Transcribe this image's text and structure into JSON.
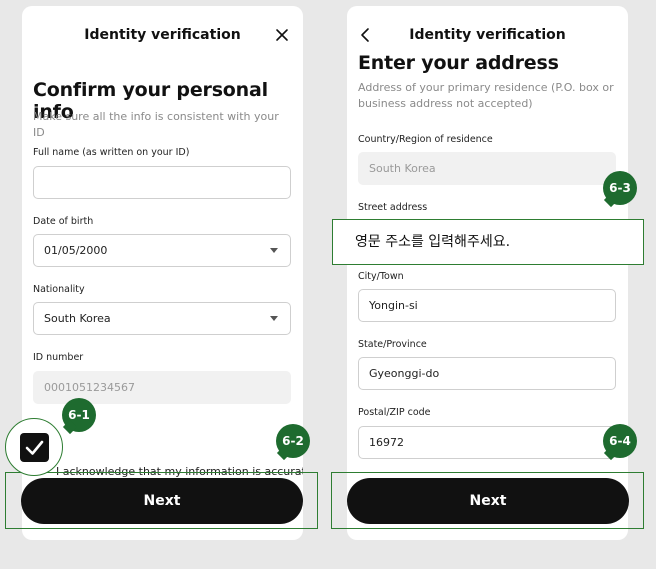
{
  "left": {
    "header_title": "Identity verification",
    "title": "Confirm your personal info",
    "subtitle": "Make sure all the info is consistent with your ID",
    "full_name": {
      "label": "Full name (as written on your ID)",
      "value": ""
    },
    "dob": {
      "label": "Date of birth",
      "value": "01/05/2000"
    },
    "nationality": {
      "label": "Nationality",
      "value": "South Korea"
    },
    "id_number": {
      "label": "ID number",
      "value": "0001051234567"
    },
    "acknowledge": "I acknowledge that my information is accurate",
    "next": "Next"
  },
  "right": {
    "header_title": "Identity verification",
    "title": "Enter your address",
    "subtitle": "Address of your primary residence (P.O. box or business address not accepted)",
    "country": {
      "label": "Country/Region of residence",
      "value": "South Korea"
    },
    "street": {
      "label": "Street address"
    },
    "city": {
      "label": "City/Town",
      "value": "Yongin-si"
    },
    "state": {
      "label": "State/Province",
      "value": "Gyeonggi-do"
    },
    "postal": {
      "label": "Postal/ZIP code",
      "value": "16972"
    },
    "next": "Next"
  },
  "annotations": {
    "b61": "6-1",
    "b62": "6-2",
    "b63": "6-3",
    "b64": "6-4",
    "korean_tip": "영문 주소를 입력해주세요."
  },
  "colors": {
    "accent": "#1e6b2f",
    "button": "#111111"
  }
}
